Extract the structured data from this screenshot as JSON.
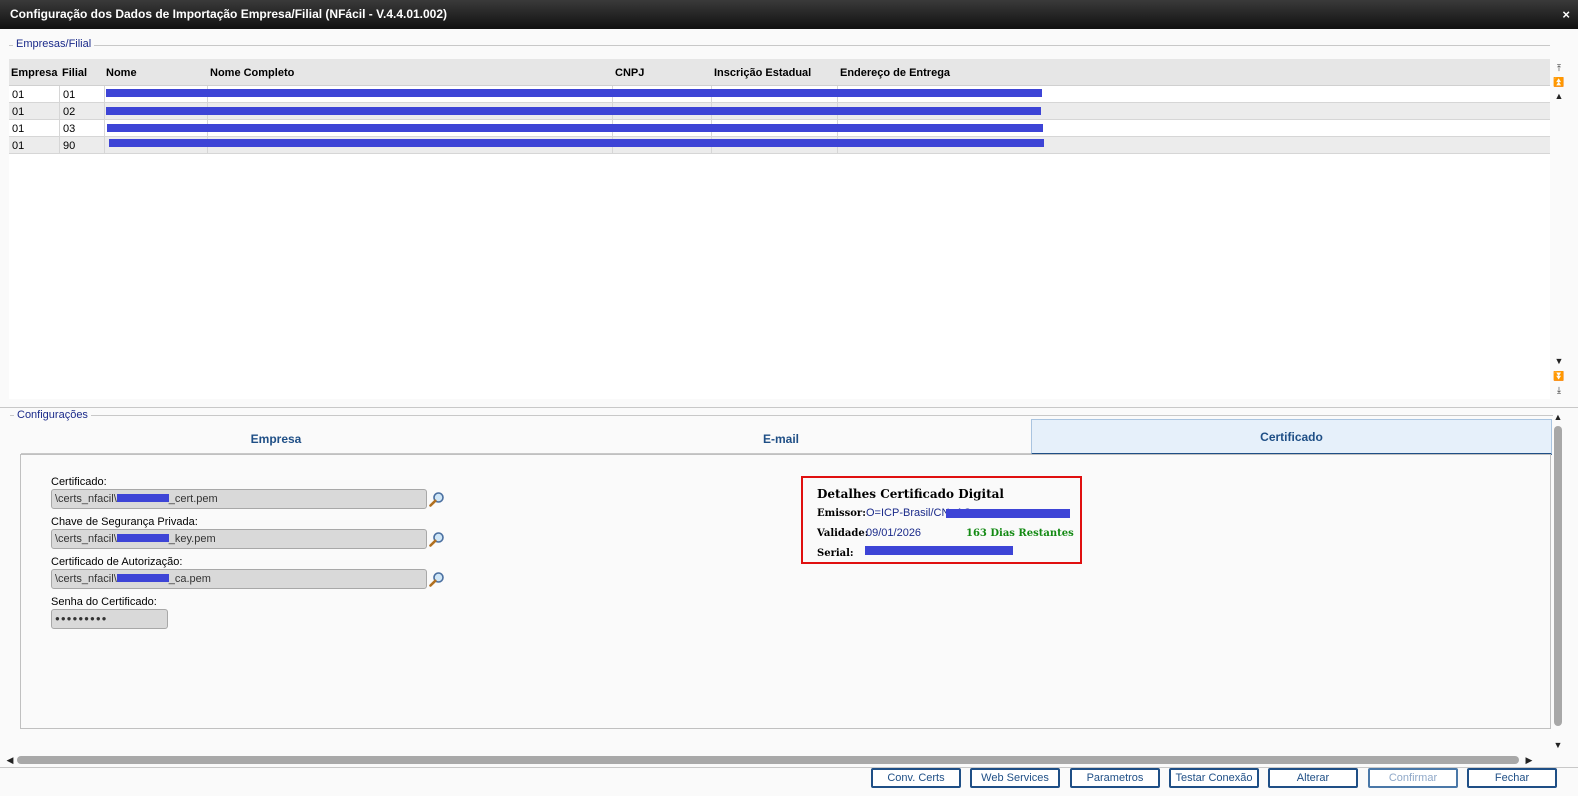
{
  "window": {
    "title": "Configuração dos Dados de Importação Empresa/Filial (NFácil - V.4.4.01.002)",
    "close": "×"
  },
  "empresas": {
    "legend": "Empresas/Filial",
    "columns": [
      "Empresa",
      "Filial",
      "Nome",
      "Nome Completo",
      "CNPJ",
      "Inscrição Estadual",
      "Endereço de Entrega"
    ],
    "rows": [
      {
        "empresa": "01",
        "filial": "01"
      },
      {
        "empresa": "01",
        "filial": "02"
      },
      {
        "empresa": "01",
        "filial": "03"
      },
      {
        "empresa": "01",
        "filial": "90"
      }
    ]
  },
  "config": {
    "legend": "Configurações",
    "tabs": [
      "Empresa",
      "E-mail",
      "Certificado"
    ],
    "active_tab": "Certificado",
    "certificado_label": "Certificado:",
    "certificado_value_prefix": "\\certs_nfacil\\",
    "certificado_value_suffix": "_cert.pem",
    "chave_label": "Chave de Segurança Privada:",
    "chave_value_prefix": "\\certs_nfacil\\",
    "chave_value_suffix": "_key.pem",
    "autorizacao_label": "Certificado de Autorização:",
    "autorizacao_value_prefix": "\\certs_nfacil\\",
    "autorizacao_value_suffix": "_ca.pem",
    "senha_label": "Senha do Certificado:",
    "senha_value": "●●●●●●●●●"
  },
  "detalhes": {
    "title": "Detalhes Certificado Digital",
    "emissor_label": "Emissor:",
    "emissor_value": "O=ICP-Brasil/CN=AC",
    "validade_label": "Validade:",
    "validade_value": "09/01/2026",
    "dias_restantes": "163 Dias Restantes",
    "serial_label": "Serial:"
  },
  "buttons": {
    "conv_certs": "Conv. Certs",
    "web_services": "Web Services",
    "parametros": "Parametros",
    "testar_conexao": "Testar Conexão",
    "alterar": "Alterar",
    "confirmar": "Confirmar",
    "fechar": "Fechar"
  },
  "icons": {
    "lookup": "magnifier-icon"
  },
  "colors": {
    "accent": "#1f4f86",
    "redaction": "#3d44d6",
    "highlight": "#e01010",
    "ok": "#138a13"
  }
}
